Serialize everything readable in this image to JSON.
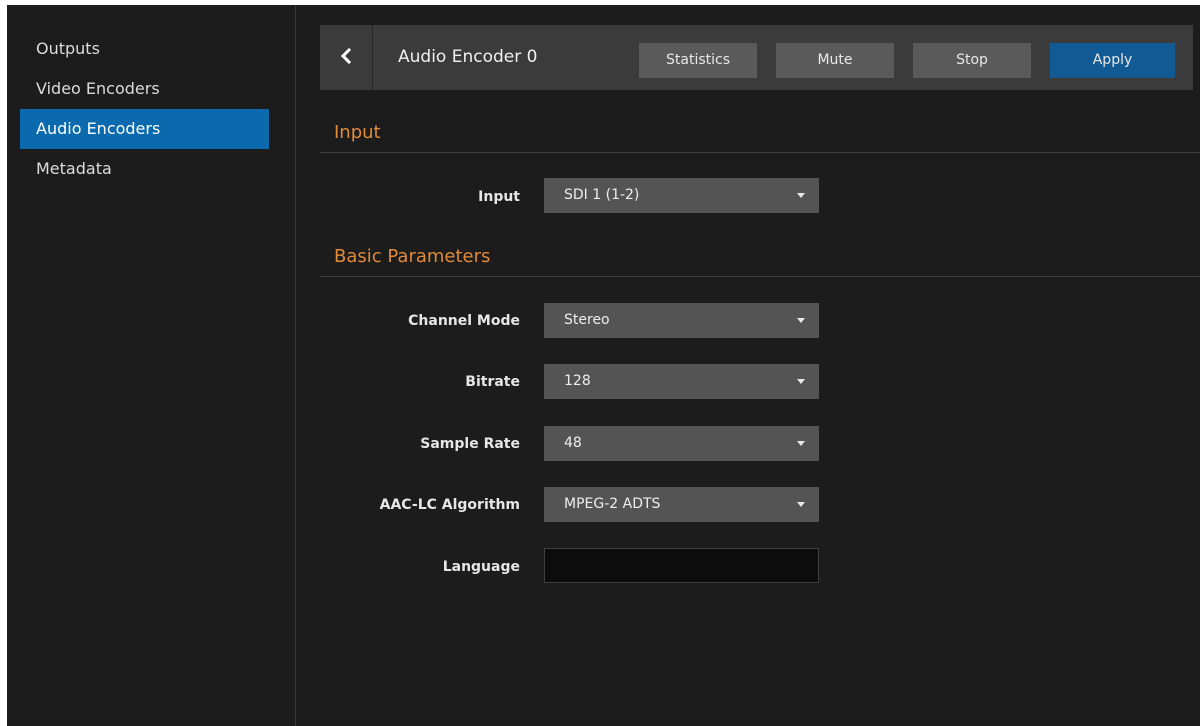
{
  "sidebar": {
    "items": [
      {
        "label": "Outputs",
        "active": false
      },
      {
        "label": "Video Encoders",
        "active": false
      },
      {
        "label": "Audio Encoders",
        "active": true
      },
      {
        "label": "Metadata",
        "active": false
      }
    ]
  },
  "toolbar": {
    "back_icon": "chevron-left-icon",
    "title": "Audio Encoder 0",
    "buttons": {
      "statistics": "Statistics",
      "mute": "Mute",
      "stop": "Stop",
      "apply": "Apply"
    }
  },
  "sections": {
    "input": {
      "title": "Input",
      "fields": {
        "input": {
          "label": "Input",
          "value": "SDI 1 (1-2)"
        }
      }
    },
    "basic": {
      "title": "Basic Parameters",
      "fields": {
        "channel_mode": {
          "label": "Channel Mode",
          "value": "Stereo"
        },
        "bitrate": {
          "label": "Bitrate",
          "value": "128"
        },
        "sample_rate": {
          "label": "Sample Rate",
          "value": "48"
        },
        "aac_algorithm": {
          "label": "AAC-LC Algorithm",
          "value": "MPEG-2 ADTS"
        },
        "language": {
          "label": "Language",
          "value": ""
        }
      }
    }
  },
  "colors": {
    "background": "#1c1c1c",
    "sidebar_active": "#0b6aad",
    "toolbar": "#3b3b3b",
    "button": "#5a5a5a",
    "primary_button": "#125a94",
    "section_title": "#e08a3a",
    "select_bg": "#545454",
    "input_bg": "#0c0c0c"
  }
}
